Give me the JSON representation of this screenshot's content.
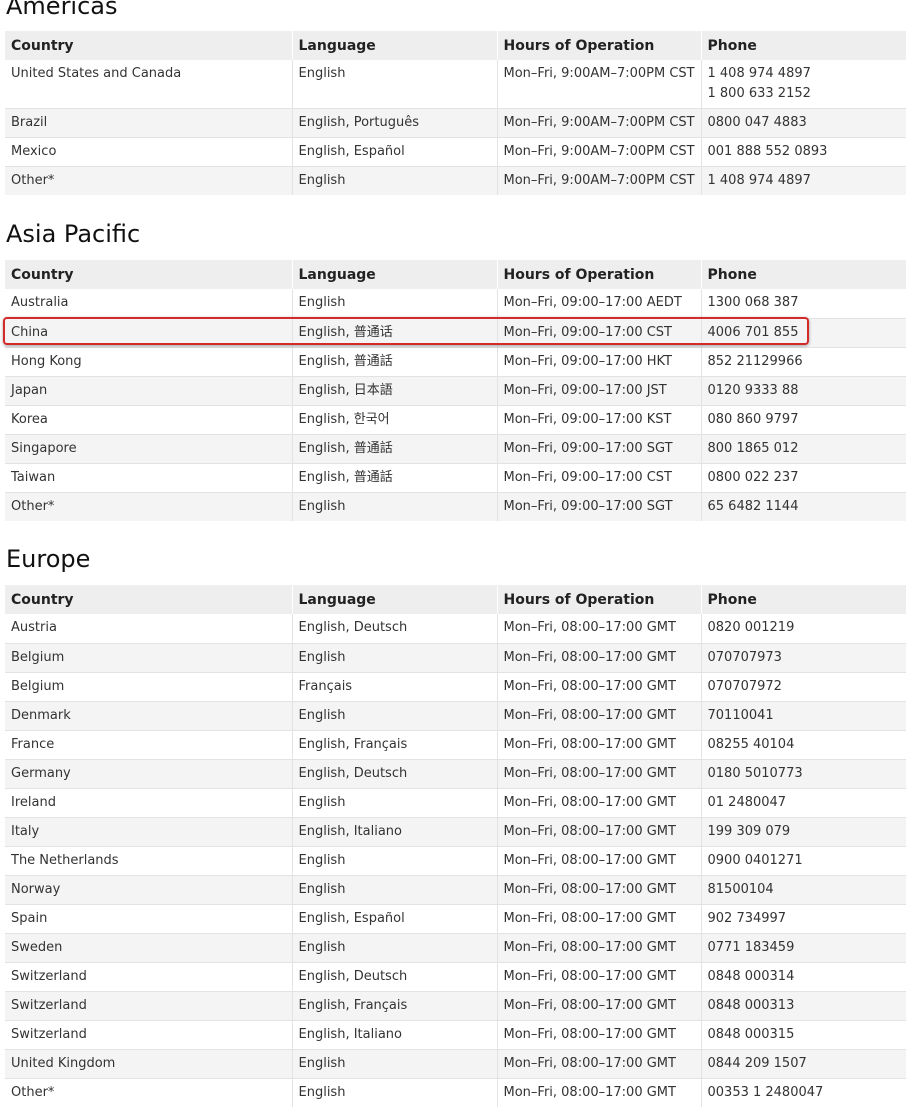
{
  "headers": {
    "country": "Country",
    "language": "Language",
    "hours": "Hours of Operation",
    "phone": "Phone"
  },
  "regions": [
    {
      "name": "Americas",
      "rows": [
        {
          "country": "United States and Canada",
          "language": "English",
          "hours": "Mon–Fri, 9:00AM–7:00PM CST",
          "phones": [
            "1 408 974 4897",
            "1 800 633 2152"
          ]
        },
        {
          "country": "Brazil",
          "language": "English, Português",
          "hours": "Mon–Fri, 9:00AM–7:00PM CST",
          "phones": [
            "0800 047 4883"
          ]
        },
        {
          "country": "Mexico",
          "language": "English, Español",
          "hours": "Mon–Fri, 9:00AM–7:00PM CST",
          "phones": [
            "001 888 552 0893"
          ]
        },
        {
          "country": "Other*",
          "language": "English",
          "hours": "Mon–Fri, 9:00AM–7:00PM CST",
          "phones": [
            "1 408 974 4897"
          ]
        }
      ]
    },
    {
      "name": "Asia Pacific",
      "rows": [
        {
          "country": "Australia",
          "language": "English",
          "hours": "Mon–Fri, 09:00–17:00 AEDT",
          "phones": [
            "1300 068 387"
          ]
        },
        {
          "country": "China",
          "language": "English, 普通话",
          "hours": "Mon–Fri, 09:00–17:00 CST",
          "phones": [
            "4006 701 855"
          ],
          "highlighted": true
        },
        {
          "country": "Hong Kong",
          "language": "English, 普通話",
          "hours": "Mon–Fri, 09:00–17:00 HKT",
          "phones": [
            "852 21129966"
          ]
        },
        {
          "country": "Japan",
          "language": "English, 日本語",
          "hours": "Mon–Fri, 09:00–17:00 JST",
          "phones": [
            "0120 9333 88"
          ]
        },
        {
          "country": "Korea",
          "language": "English, 한국어",
          "hours": "Mon–Fri, 09:00–17:00 KST",
          "phones": [
            "080 860 9797"
          ]
        },
        {
          "country": "Singapore",
          "language": "English, 普通話",
          "hours": "Mon–Fri, 09:00–17:00 SGT",
          "phones": [
            "800 1865 012"
          ]
        },
        {
          "country": "Taiwan",
          "language": "English, 普通話",
          "hours": "Mon–Fri, 09:00–17:00 CST",
          "phones": [
            "0800 022 237"
          ]
        },
        {
          "country": "Other*",
          "language": "English",
          "hours": "Mon–Fri, 09:00–17:00 SGT",
          "phones": [
            "65 6482 1144"
          ]
        }
      ]
    },
    {
      "name": "Europe",
      "rows": [
        {
          "country": "Austria",
          "language": "English, Deutsch",
          "hours": "Mon–Fri, 08:00–17:00 GMT",
          "phones": [
            "0820 001219"
          ]
        },
        {
          "country": "Belgium",
          "language": "English",
          "hours": "Mon–Fri, 08:00–17:00 GMT",
          "phones": [
            "070707973"
          ]
        },
        {
          "country": "Belgium",
          "language": "Français",
          "hours": "Mon–Fri, 08:00–17:00 GMT",
          "phones": [
            "070707972"
          ]
        },
        {
          "country": "Denmark",
          "language": "English",
          "hours": "Mon–Fri, 08:00–17:00 GMT",
          "phones": [
            "70110041"
          ]
        },
        {
          "country": "France",
          "language": "English, Français",
          "hours": "Mon–Fri, 08:00–17:00 GMT",
          "phones": [
            "08255 40104"
          ]
        },
        {
          "country": "Germany",
          "language": "English, Deutsch",
          "hours": "Mon–Fri, 08:00–17:00 GMT",
          "phones": [
            "0180 5010773"
          ]
        },
        {
          "country": "Ireland",
          "language": "English",
          "hours": "Mon–Fri, 08:00–17:00 GMT",
          "phones": [
            "01 2480047"
          ]
        },
        {
          "country": "Italy",
          "language": "English, Italiano",
          "hours": "Mon–Fri, 08:00–17:00 GMT",
          "phones": [
            "199 309 079"
          ]
        },
        {
          "country": "The Netherlands",
          "language": "English",
          "hours": "Mon–Fri, 08:00–17:00 GMT",
          "phones": [
            "0900 0401271"
          ]
        },
        {
          "country": "Norway",
          "language": "English",
          "hours": "Mon–Fri, 08:00–17:00 GMT",
          "phones": [
            "81500104"
          ]
        },
        {
          "country": "Spain",
          "language": "English, Español",
          "hours": "Mon–Fri, 08:00–17:00 GMT",
          "phones": [
            "902 734997"
          ]
        },
        {
          "country": "Sweden",
          "language": "English",
          "hours": "Mon–Fri, 08:00–17:00 GMT",
          "phones": [
            "0771 183459"
          ]
        },
        {
          "country": "Switzerland",
          "language": "English, Deutsch",
          "hours": "Mon–Fri, 08:00–17:00 GMT",
          "phones": [
            "0848 000314"
          ]
        },
        {
          "country": "Switzerland",
          "language": "English, Français",
          "hours": "Mon–Fri, 08:00–17:00 GMT",
          "phones": [
            "0848 000313"
          ]
        },
        {
          "country": "Switzerland",
          "language": "English, Italiano",
          "hours": "Mon–Fri, 08:00–17:00 GMT",
          "phones": [
            "0848 000315"
          ]
        },
        {
          "country": "United Kingdom",
          "language": "English",
          "hours": "Mon–Fri, 08:00–17:00 GMT",
          "phones": [
            "0844 209 1507"
          ]
        },
        {
          "country": "Other*",
          "language": "English",
          "hours": "Mon–Fri, 08:00–17:00 GMT",
          "phones": [
            "00353 1 2480047"
          ]
        }
      ]
    }
  ],
  "colors": {
    "highlight_border": "#d42a2a",
    "header_bg": "#eeeeee",
    "stripe_bg": "#f4f4f4"
  }
}
